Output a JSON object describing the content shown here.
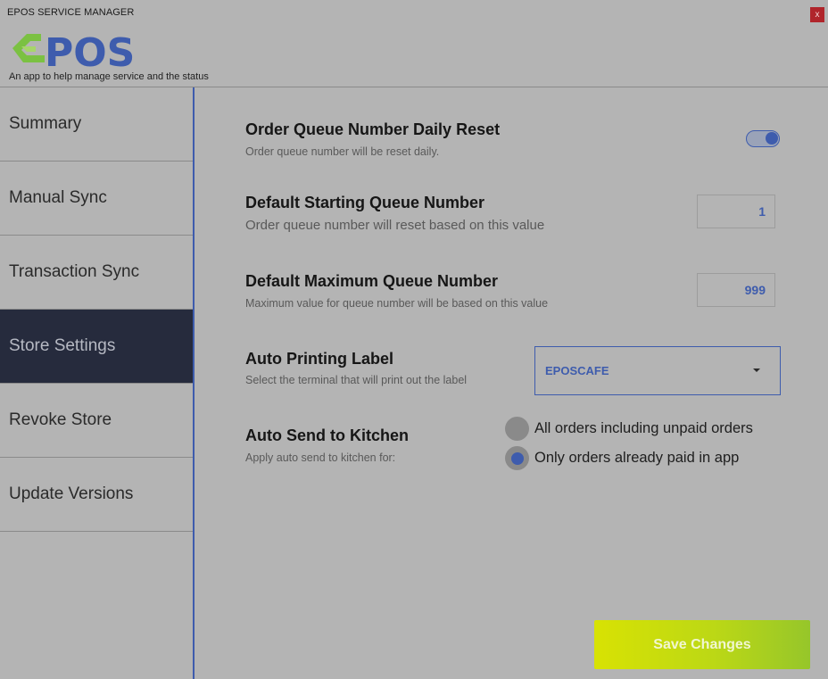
{
  "window": {
    "title": "EPOS SERVICE MANAGER",
    "close_label": "x"
  },
  "brand": {
    "logo_text": "POS",
    "tagline": "An app to help manage service and the status",
    "accent_color": "#3e5cad",
    "logo_green": "#7bc142"
  },
  "sidebar": {
    "items": [
      {
        "label": "Summary",
        "active": false
      },
      {
        "label": "Manual Sync",
        "active": false
      },
      {
        "label": "Transaction Sync",
        "active": false
      },
      {
        "label": "Store Settings",
        "active": true
      },
      {
        "label": "Revoke Store",
        "active": false
      },
      {
        "label": "Update Versions",
        "active": false
      }
    ]
  },
  "settings": {
    "daily_reset": {
      "title": "Order Queue Number Daily Reset",
      "description": "Order queue number will be reset daily.",
      "enabled": true
    },
    "starting_number": {
      "title": "Default Starting Queue Number",
      "description": "Order queue number will reset based on this value",
      "value": "1"
    },
    "maximum_number": {
      "title": "Default Maximum Queue Number",
      "description": "Maximum value for queue number will be based on this value",
      "value": "999"
    },
    "auto_printing": {
      "title": "Auto Printing Label",
      "description": "Select the terminal that will print out the label",
      "selected": "EPOSCAFE"
    },
    "auto_send": {
      "title": "Auto Send to Kitchen",
      "description": "Apply auto send to kitchen for:",
      "options": [
        {
          "label": "All orders including unpaid orders",
          "selected": false
        },
        {
          "label": "Only orders already paid in app",
          "selected": true
        }
      ]
    }
  },
  "actions": {
    "save_label": "Save Changes"
  }
}
